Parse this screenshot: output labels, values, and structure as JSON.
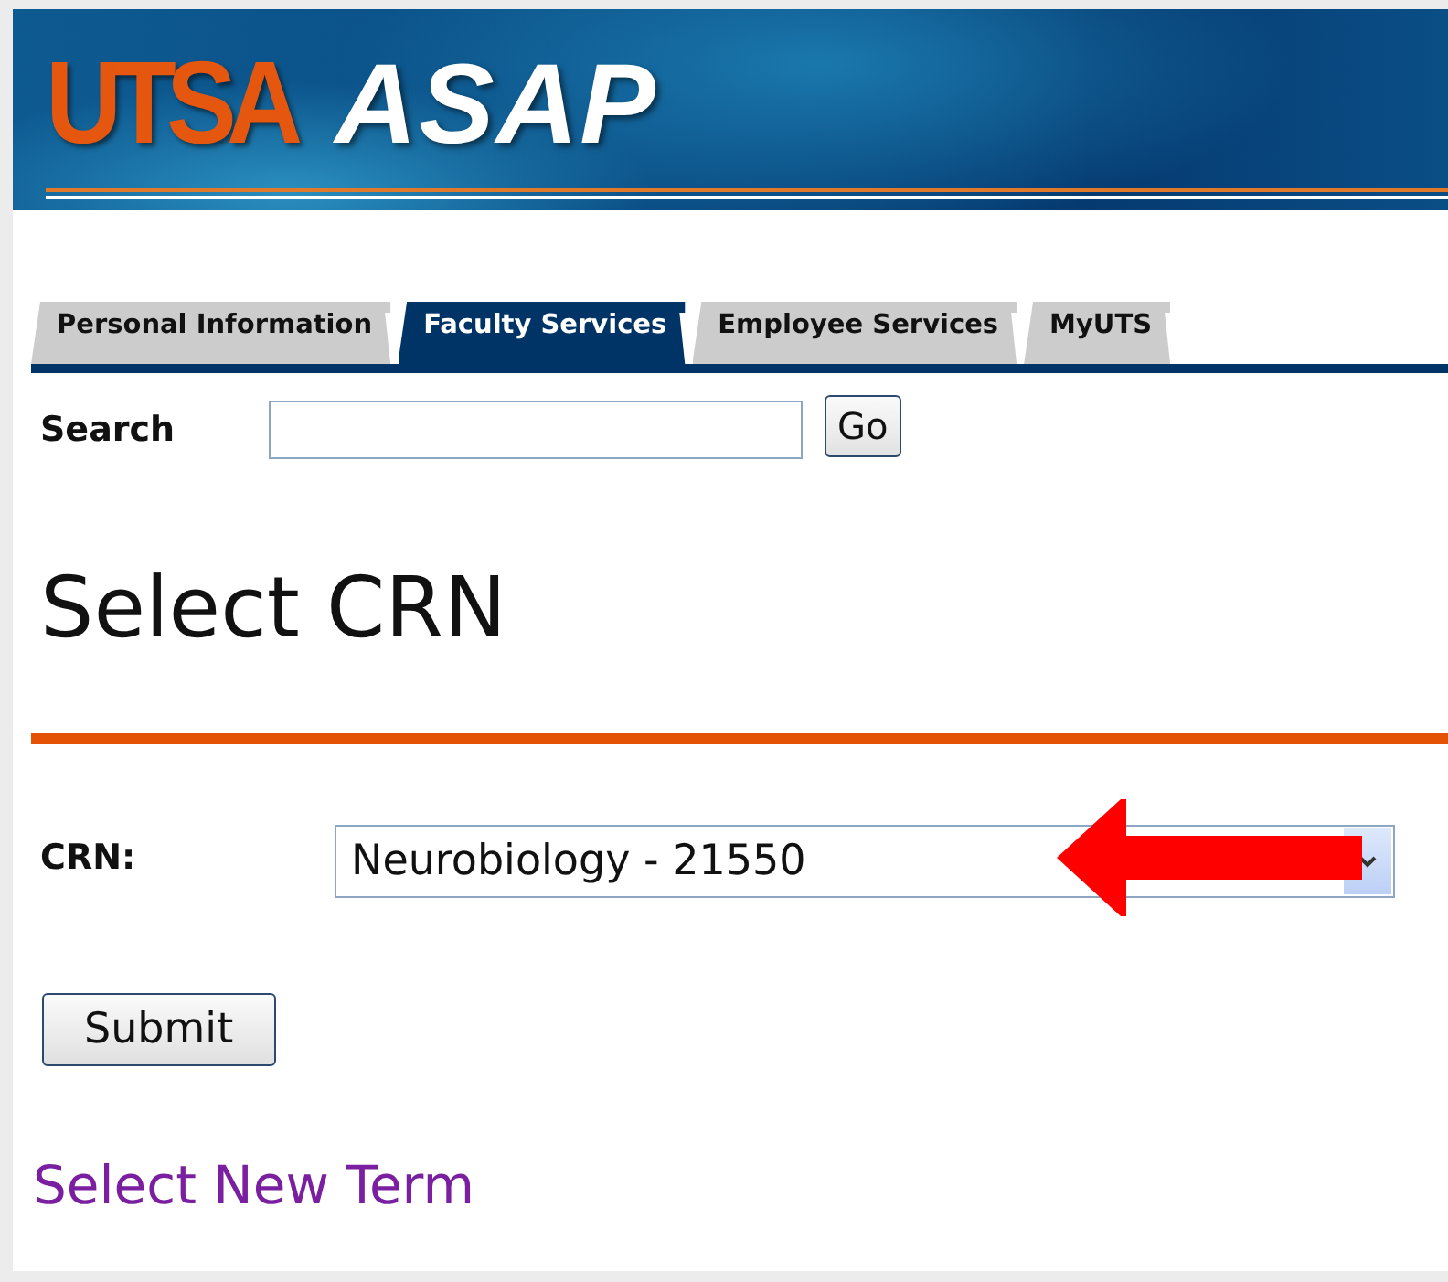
{
  "header": {
    "logo_mark": "UTSA",
    "logo_text": "ASAP"
  },
  "tabs": [
    {
      "label": "Personal Information",
      "selected": false
    },
    {
      "label": "Faculty Services",
      "selected": true
    },
    {
      "label": "Employee Services",
      "selected": false
    },
    {
      "label": "MyUTS",
      "selected": false
    }
  ],
  "search": {
    "label": "Search",
    "button": "Go"
  },
  "heading": "Select CRN",
  "crn": {
    "label": "CRN:",
    "value": "Neurobiology - 21550"
  },
  "submit": "Submit",
  "link": "Select New Term"
}
